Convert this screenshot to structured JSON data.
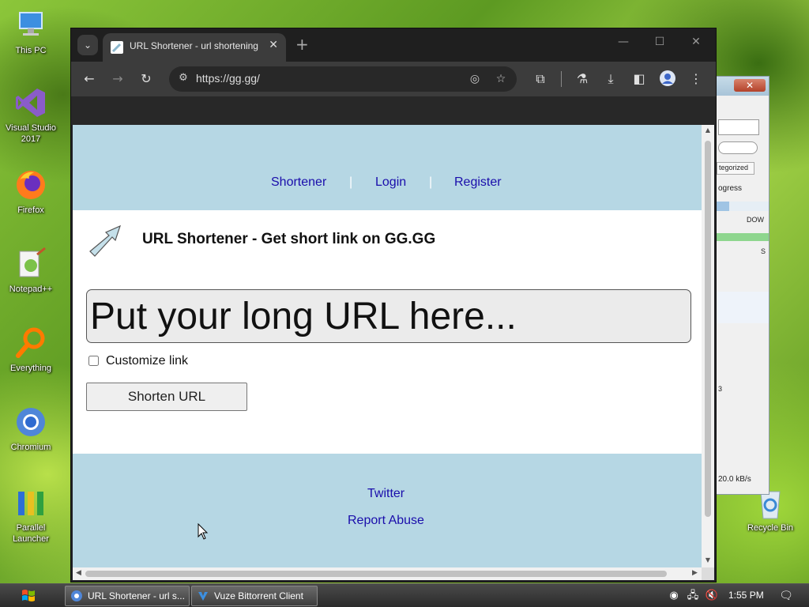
{
  "desktop": {
    "icons": [
      {
        "label": "This PC"
      },
      {
        "label": "Visual Studio 2017"
      },
      {
        "label": "Firefox"
      },
      {
        "label": "Notepad++"
      },
      {
        "label": "Everything"
      },
      {
        "label": "Chromium"
      },
      {
        "label": "Parallel Launcher"
      }
    ],
    "recycle_bin": {
      "label": "Recycle Bin"
    }
  },
  "background_window": {
    "texts": [
      "tegorized",
      "ogress",
      "DOW",
      "S",
      "20.0 kB/s",
      "3"
    ]
  },
  "browser": {
    "tab": {
      "title": "URL Shortener - url shortening"
    },
    "address": {
      "url": "https://gg.gg/"
    }
  },
  "page": {
    "nav": {
      "shortener": "Shortener",
      "login": "Login",
      "register": "Register",
      "separator": "|"
    },
    "headline": "URL Shortener - Get short link on GG.GG",
    "url_input": {
      "placeholder": "Put your long URL here..."
    },
    "customize_label": "Customize link",
    "shorten_button": "Shorten URL",
    "footer": {
      "twitter": "Twitter",
      "report_abuse": "Report Abuse"
    }
  },
  "taskbar": {
    "items": [
      {
        "label": "URL Shortener - url s..."
      },
      {
        "label": "Vuze Bittorrent Client"
      }
    ],
    "clock": "1:55 PM"
  },
  "colors": {
    "page_band": "#b6d7e4",
    "link": "#1a0dab",
    "chrome_dark": "#3c3c3c"
  }
}
